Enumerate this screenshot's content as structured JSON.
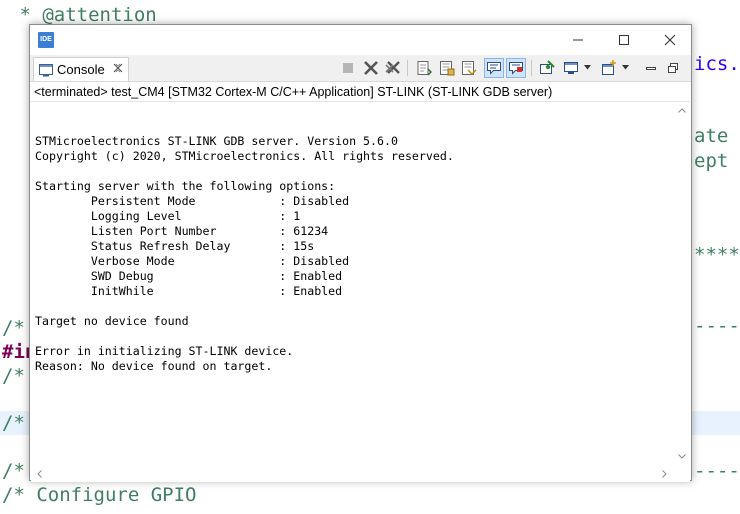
{
  "editor": {
    "line_attention": " * @attention",
    "line_ics": "ics.",
    "line_ate": "ate l",
    "line_ept": "ept i",
    "line_stars": "*****",
    "line_comment1": "/*",
    "line_inc": "#in",
    "line_comment2": "/*",
    "line_comment3": "/*",
    "line_comment4": "/*",
    "line_configure": "/* Configure GPIO",
    "dashes": "-------"
  },
  "window": {
    "icon_text": "IDE",
    "tab_label": "Console",
    "status": "<terminated> test_CM4 [STM32 Cortex-M C/C++ Application] ST-LINK (ST-LINK GDB server)"
  },
  "console": {
    "output": "STMicroelectronics ST-LINK GDB server. Version 5.6.0\nCopyright (c) 2020, STMicroelectronics. All rights reserved.\n\nStarting server with the following options:\n        Persistent Mode            : Disabled\n        Logging Level              : 1\n        Listen Port Number         : 61234\n        Status Refresh Delay       : 15s\n        Verbose Mode               : Disabled\n        SWD Debug                  : Enabled\n        InitWhile                  : Enabled\n\nTarget no device found\n\nError in initializing ST-LINK device.\nReason: No device found on target."
  },
  "colors": {
    "comment": "#3f7f5f",
    "keyword": "#7f0055",
    "highlight": "#e8f2fe",
    "active_button": "#cfe4fa"
  },
  "icons": [
    "ide-app-icon",
    "minimize-icon",
    "maximize-icon",
    "close-icon",
    "console-icon",
    "tab-close-icon",
    "terminate-icon",
    "remove-launch-icon",
    "remove-all-icon",
    "scroll-lock-icon",
    "word-wrap-icon",
    "show-output-icon",
    "show-stdout-icon",
    "show-stderr-icon",
    "pin-console-icon",
    "display-console-icon",
    "new-console-icon",
    "view-minimize-icon",
    "view-maximize-icon"
  ]
}
